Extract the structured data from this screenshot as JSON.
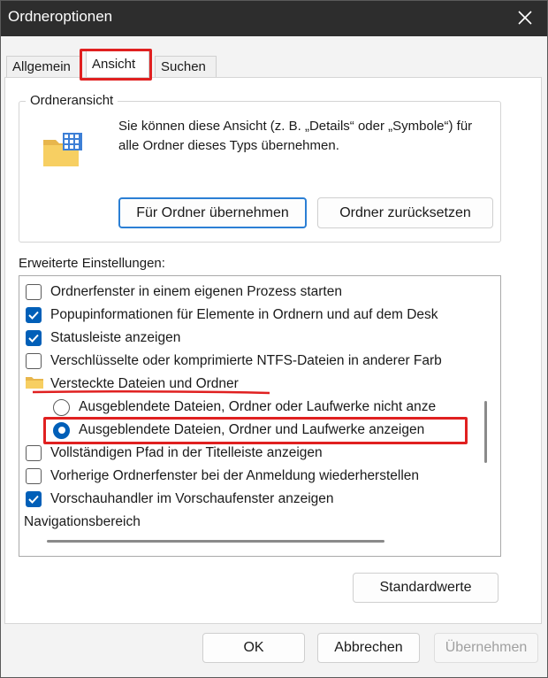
{
  "window": {
    "title": "Ordneroptionen"
  },
  "tabs": [
    {
      "label": "Allgemein"
    },
    {
      "label": "Ansicht"
    },
    {
      "label": "Suchen"
    }
  ],
  "folder_view": {
    "legend": "Ordneransicht",
    "description": "Sie können diese Ansicht (z. B. „Details“ oder „Symbole“) für alle Ordner dieses Typs übernehmen.",
    "apply_button": "Für Ordner übernehmen",
    "reset_button": "Ordner zurücksetzen"
  },
  "advanced": {
    "label": "Erweiterte Einstellungen:",
    "items": [
      {
        "type": "checkbox",
        "checked": false,
        "label": "Ordnerfenster in einem eigenen Prozess starten"
      },
      {
        "type": "checkbox",
        "checked": true,
        "label": "Popupinformationen für Elemente in Ordnern und auf dem Desk"
      },
      {
        "type": "checkbox",
        "checked": true,
        "label": "Statusleiste anzeigen"
      },
      {
        "type": "checkbox",
        "checked": false,
        "label": "Verschlüsselte oder komprimierte NTFS-Dateien in anderer Farb"
      },
      {
        "type": "folder",
        "label": "Versteckte Dateien und Ordner"
      },
      {
        "type": "radio",
        "checked": false,
        "label": "Ausgeblendete Dateien, Ordner oder Laufwerke nicht anze"
      },
      {
        "type": "radio",
        "checked": true,
        "label": "Ausgeblendete Dateien, Ordner und Laufwerke anzeigen"
      },
      {
        "type": "checkbox",
        "checked": false,
        "label": "Vollständigen Pfad in der Titelleiste anzeigen"
      },
      {
        "type": "checkbox",
        "checked": false,
        "label": "Vorherige Ordnerfenster bei der Anmeldung wiederherstellen"
      },
      {
        "type": "checkbox",
        "checked": true,
        "label": "Vorschauhandler im Vorschaufenster anzeigen"
      },
      {
        "type": "header",
        "label": "Navigationsbereich"
      }
    ]
  },
  "buttons": {
    "defaults": "Standardwerte",
    "ok": "OK",
    "cancel": "Abbrechen",
    "apply": "Übernehmen"
  },
  "colors": {
    "accent": "#005fb8",
    "highlight": "#e02020",
    "titlebar": "#2d2d2d"
  }
}
